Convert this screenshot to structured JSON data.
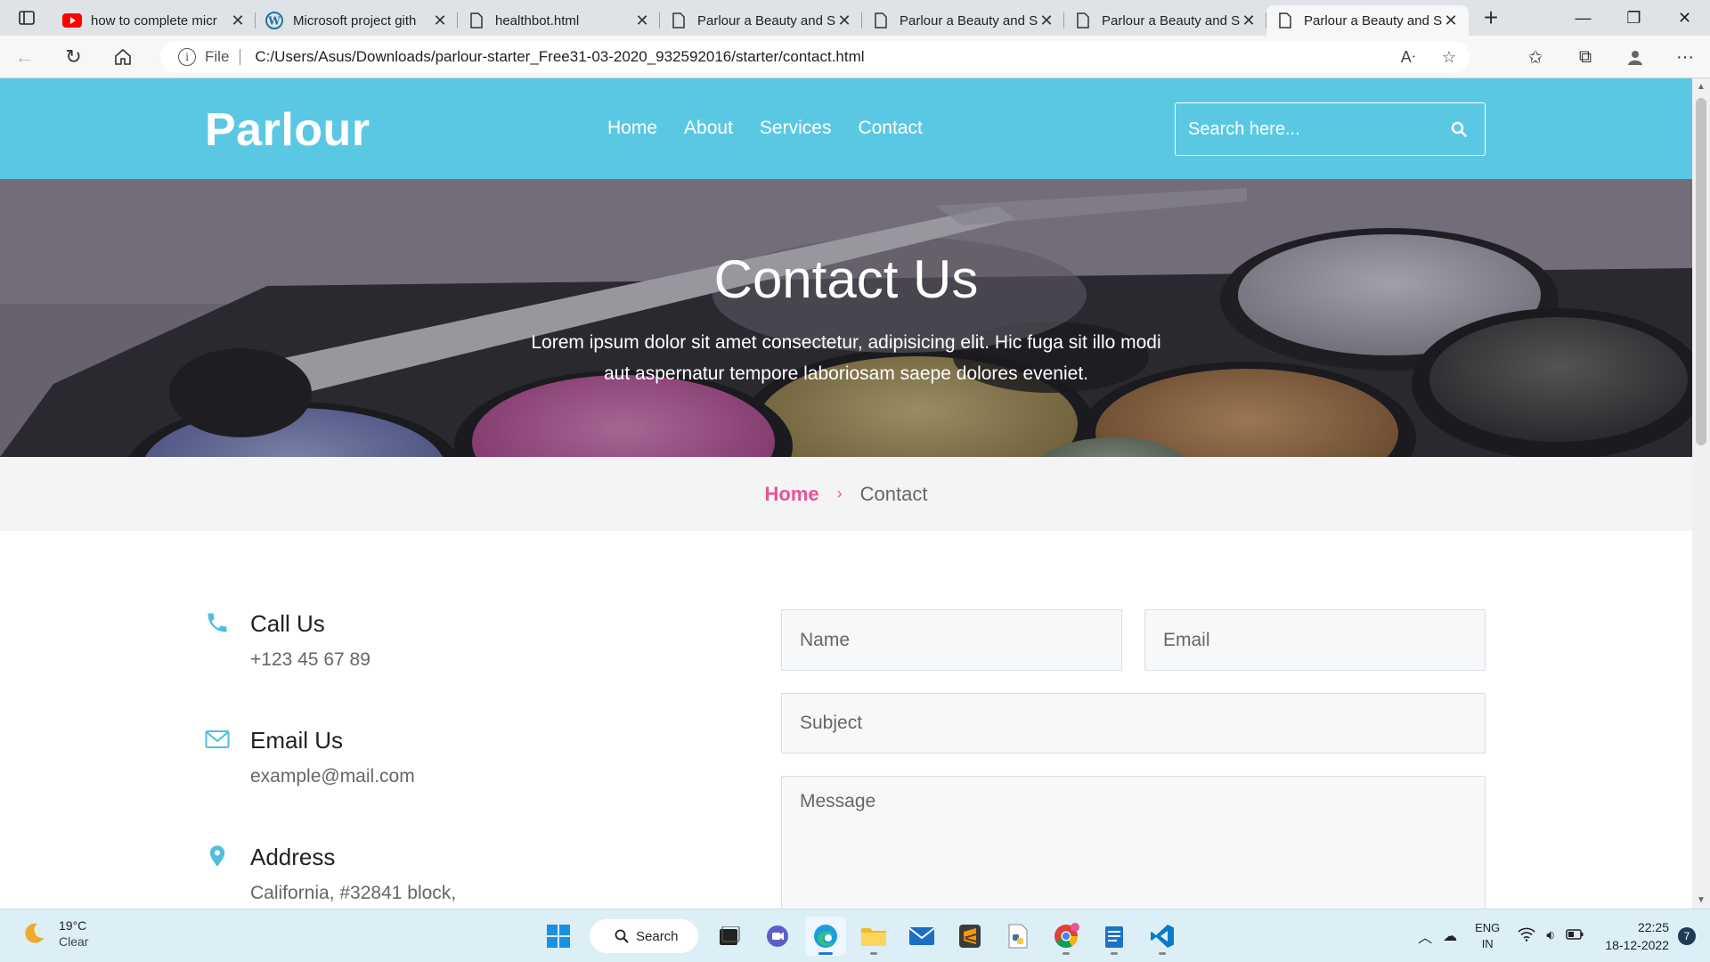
{
  "browser": {
    "tabs": [
      {
        "title": "how to complete micr",
        "icon": "youtube-icon"
      },
      {
        "title": "Microsoft project gith",
        "icon": "wordpress-icon"
      },
      {
        "title": "healthbot.html",
        "icon": "file-icon"
      },
      {
        "title": "Parlour a Beauty and S",
        "icon": "file-icon"
      },
      {
        "title": "Parlour a Beauty and S",
        "icon": "file-icon"
      },
      {
        "title": "Parlour a Beauty and S",
        "icon": "file-icon"
      },
      {
        "title": "Parlour a Beauty and S",
        "icon": "file-icon",
        "active": true
      }
    ],
    "address": {
      "scheme": "File",
      "url": "C:/Users/Asus/Downloads/parlour-starter_Free31-03-2020_932592016/starter/contact.html"
    }
  },
  "site": {
    "logo": "Parlour",
    "nav": [
      "Home",
      "About",
      "Services",
      "Contact"
    ],
    "search_placeholder": "Search here...",
    "hero": {
      "title": "Contact Us",
      "text": "Lorem ipsum dolor sit amet consectetur, adipisicing elit. Hic fuga sit illo modi aut aspernatur tempore laboriosam saepe dolores eveniet."
    },
    "breadcrumb": {
      "home": "Home",
      "separator": "›",
      "current": "Contact"
    },
    "contact": [
      {
        "heading": "Call Us",
        "value": "+123 45 67 89",
        "icon": "phone-icon"
      },
      {
        "heading": "Email Us",
        "value": "example@mail.com",
        "icon": "mail-icon"
      },
      {
        "heading": "Address",
        "value": "California, #32841 block,",
        "icon": "location-pin-icon"
      }
    ],
    "form": {
      "name_placeholder": "Name",
      "email_placeholder": "Email",
      "subject_placeholder": "Subject",
      "message_placeholder": "Message"
    },
    "colors": {
      "header": "#5bc8e3",
      "accent": "#e8539a"
    }
  },
  "taskbar": {
    "weather": {
      "temp": "19°C",
      "condition": "Clear"
    },
    "search_label": "Search",
    "language": {
      "line1": "ENG",
      "line2": "IN"
    },
    "time": "22:25",
    "date": "18-12-2022",
    "notifications": "7"
  }
}
